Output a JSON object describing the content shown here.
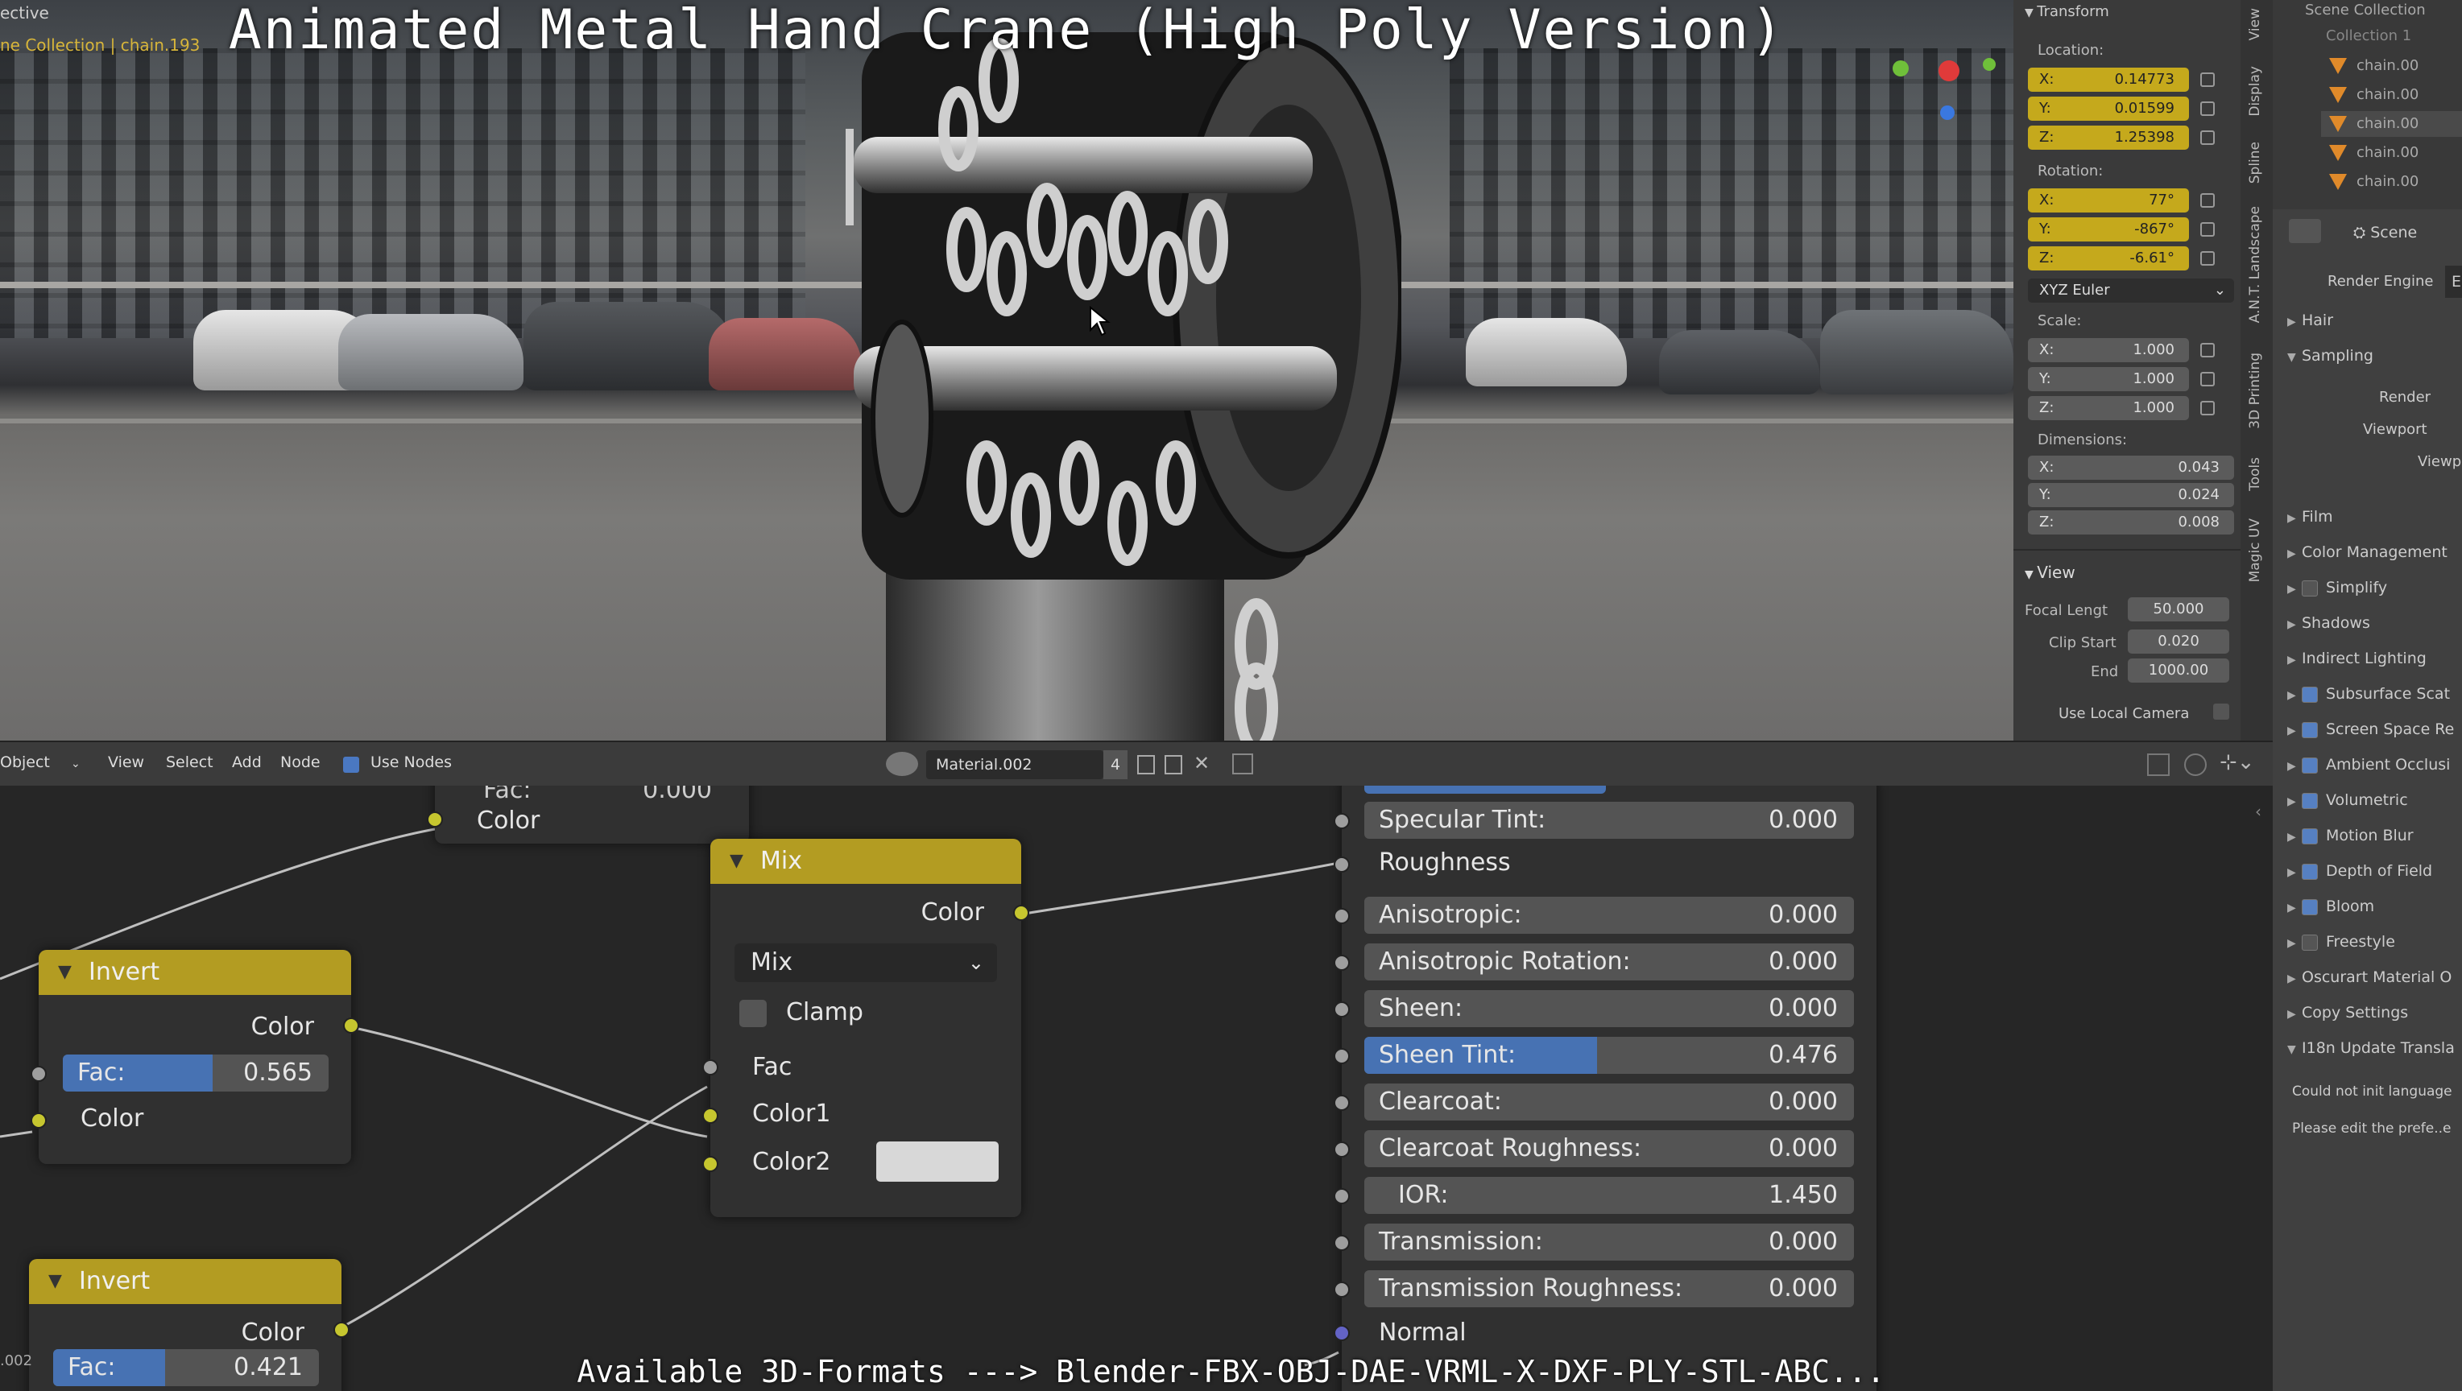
{
  "viewport": {
    "mode": "ective",
    "collection": "ne Collection | chain.193",
    "title": "Animated Metal Hand Crane (High Poly Version)"
  },
  "transform_panel": {
    "title": "Transform",
    "location_label": "Location:",
    "location": {
      "x": "0.14773",
      "y": "0.01599",
      "z": "1.25398"
    },
    "rotation_label": "Rotation:",
    "rotation": {
      "x": "77°",
      "y": "-867°",
      "z": "-6.61°"
    },
    "rotation_mode": "XYZ Euler",
    "scale_label": "Scale:",
    "scale": {
      "x": "1.000",
      "y": "1.000",
      "z": "1.000"
    },
    "dimensions_label": "Dimensions:",
    "dimensions": {
      "x": "0.043",
      "y": "0.024",
      "z": "0.008"
    },
    "view_title": "View",
    "focal_label": "Focal Lengt",
    "focal": "50.000",
    "clip_start_label": "Clip Start",
    "clip_start": "0.020",
    "end_label": "End",
    "end": "1000.00",
    "local_camera_label": "Use Local Camera"
  },
  "vertical_tabs": [
    "View",
    "Display",
    "Spline",
    "A.N.T. Landscape",
    "3D Printing",
    "Tools",
    "Magic UV"
  ],
  "outliner": {
    "title": "Scene Collection",
    "collection": "Collection 1",
    "items": [
      "chain.00",
      "chain.00",
      "chain.00",
      "chain.00",
      "chain.00"
    ]
  },
  "properties": {
    "scene_label": "Scene",
    "render_engine_label": "Render Engine",
    "render_engine_value": "E",
    "hair": "Hair",
    "sampling": "Sampling",
    "render": "Render",
    "viewport": "Viewport",
    "viewp": "Viewp",
    "film": "Film",
    "color_mgmt": "Color Management",
    "simplify": "Simplify",
    "shadows": "Shadows",
    "indirect": "Indirect Lighting",
    "sss": "Subsurface Scat",
    "ssr": "Screen Space Re",
    "ao": "Ambient Occlusi",
    "volumetric": "Volumetric",
    "motion_blur": "Motion Blur",
    "dof": "Depth of Field",
    "bloom": "Bloom",
    "freestyle": "Freestyle",
    "oscurart": "Oscurart Material O",
    "copy": "Copy Settings",
    "i18n": "I18n Update Transla",
    "msg1": "Could not init language",
    "msg2": "Please edit the prefe..e"
  },
  "node_header": {
    "object": "Object",
    "view": "View",
    "select": "Select",
    "add": "Add",
    "node": "Node",
    "use_nodes": "Use Nodes",
    "material": "Material.002",
    "users": "4"
  },
  "nodes": {
    "top_partial": {
      "fac_label": "Fac:",
      "fac_value": "0.000",
      "color": "Color"
    },
    "invert1": {
      "title": "Invert",
      "color_out": "Color",
      "fac_label": "Fac:",
      "fac_value": "0.565",
      "fac": 0.565,
      "color_in": "Color"
    },
    "invert2": {
      "title": "Invert",
      "color_out": "Color",
      "fac_label": "Fac:",
      "fac_value": "0.421",
      "fac": 0.421
    },
    "mix": {
      "title": "Mix",
      "color_out": "Color",
      "blend": "Mix",
      "clamp": "Clamp",
      "fac": "Fac",
      "color1": "Color1",
      "color2": "Color2"
    },
    "principled": {
      "specular_tint_label": "Specular Tint:",
      "specular_tint": "0.000",
      "roughness": "Roughness",
      "anisotropic_label": "Anisotropic:",
      "anisotropic": "0.000",
      "aniso_rot_label": "Anisotropic Rotation:",
      "aniso_rot": "0.000",
      "sheen_label": "Sheen:",
      "sheen": "0.000",
      "sheen_tint_label": "Sheen Tint:",
      "sheen_tint": "0.476",
      "sheen_tint_frac": 0.476,
      "clearcoat_label": "Clearcoat:",
      "clearcoat": "0.000",
      "clearcoat_rough_label": "Clearcoat Roughness:",
      "clearcoat_rough": "0.000",
      "ior_label": "IOR:",
      "ior": "1.450",
      "transmission_label": "Transmission:",
      "transmission": "0.000",
      "trans_rough_label": "Transmission Roughness:",
      "trans_rough": "0.000",
      "normal": "Normal"
    }
  },
  "footer": {
    "formats": "Available 3D-Formats ---> Blender-FBX-OBJ-DAE-VRML-X-DXF-PLY-STL-ABC..."
  },
  "side_label": ".002"
}
